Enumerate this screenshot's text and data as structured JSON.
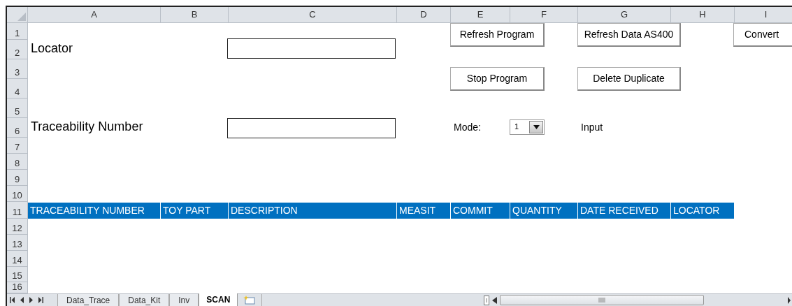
{
  "columns": [
    "A",
    "B",
    "C",
    "D",
    "E",
    "F",
    "G",
    "H",
    "I"
  ],
  "rows": [
    "1",
    "2",
    "3",
    "4",
    "5",
    "6",
    "7",
    "8",
    "9",
    "10",
    "11",
    "12",
    "13",
    "14",
    "15",
    "16"
  ],
  "labels": [
    "Locator",
    "Traceability Number"
  ],
  "mode": {
    "label": "Mode:",
    "value": "1",
    "status": "Input"
  },
  "buttons": [
    {
      "label": "Refresh Program"
    },
    {
      "label": "Refresh Data AS400"
    },
    {
      "label": "Convert"
    },
    {
      "label": "Stop Program"
    },
    {
      "label": "Delete Duplicate"
    }
  ],
  "table": {
    "columns": [
      "TRACEABILITY NUMBER",
      "TOY PART",
      "DESCRIPTION",
      "MEASIT",
      "COMMIT",
      "QUANTITY",
      "DATE RECEIVED",
      "LOCATOR"
    ]
  },
  "sheet_tabs": [
    {
      "label": "Data_Trace",
      "selected": false
    },
    {
      "label": "Data_Kit",
      "selected": false
    },
    {
      "label": "Inv",
      "selected": false
    },
    {
      "label": "SCAN",
      "selected": true
    }
  ]
}
